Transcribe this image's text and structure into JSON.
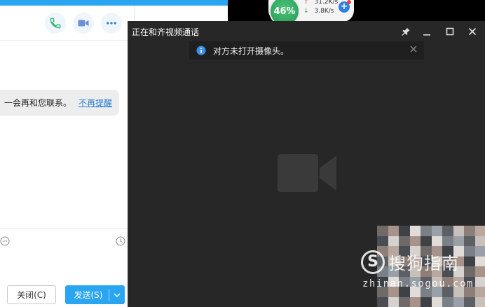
{
  "chat": {
    "message_text": "一会再和您联系。",
    "message_link": "不再提醒",
    "close_button": "关闭(C)",
    "send_button": "发送(S)"
  },
  "speed_widget": {
    "percent": "46%",
    "upload": "31.2K/s",
    "download": "3.8K/s"
  },
  "video_call": {
    "title": "正在和齐视频通话",
    "notice": "对方未打开摄像头。"
  },
  "watermark": {
    "title": "搜狗指南",
    "url": "zhinan.sogou.com"
  },
  "colors": {
    "accent": "#2aa5f1",
    "video_bg": "#272727",
    "gauge": "#2ea85a",
    "link": "#2b7fd6"
  },
  "icons": [
    "phone-icon",
    "video-icon",
    "more-icon",
    "emoji-icon",
    "history-icon",
    "pin-icon",
    "minimize-icon",
    "maximize-icon",
    "close-icon",
    "info-icon",
    "camera-off-icon",
    "chevron-down-icon"
  ]
}
